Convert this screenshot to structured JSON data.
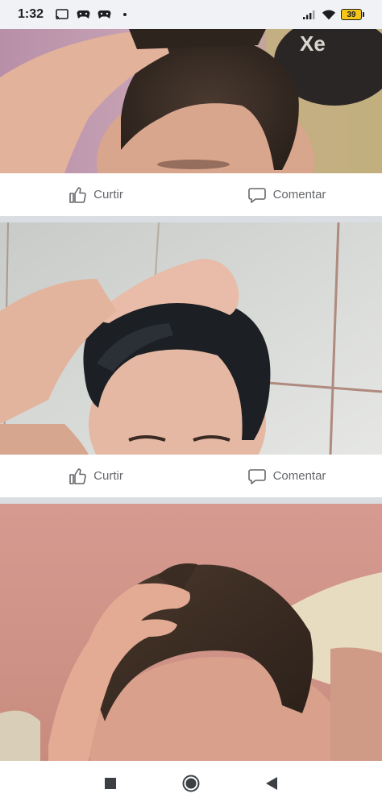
{
  "status_bar": {
    "time": "1:32",
    "battery_level": "39",
    "icons_left": [
      "cast-icon",
      "game-controller-icon",
      "game-controller-icon",
      "notification-dot-icon"
    ],
    "icons_right": [
      "signal-icon",
      "wifi-icon",
      "battery-icon"
    ],
    "battery_color": "#f5c518"
  },
  "posts": [
    {
      "photo_description_icon": "photo",
      "actions": {
        "like_label": "Curtir",
        "comment_label": "Comentar"
      }
    },
    {
      "photo_description_icon": "photo",
      "actions": {
        "like_label": "Curtir",
        "comment_label": "Comentar"
      }
    },
    {
      "photo_description_icon": "photo"
    }
  ],
  "nav_bar": {
    "buttons": [
      "recents-square-icon",
      "home-circle-icon",
      "back-triangle-icon"
    ]
  },
  "colors": {
    "action_text": "#65676b",
    "separator": "#dadde1",
    "card_background": "#ffffff"
  }
}
